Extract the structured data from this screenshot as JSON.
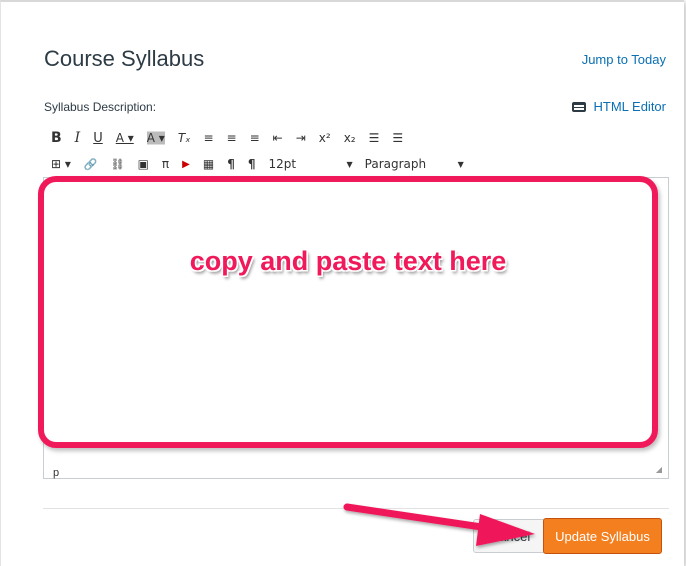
{
  "page": {
    "title": "Course Syllabus",
    "jump_link": "Jump to Today"
  },
  "editor": {
    "description_label": "Syllabus Description:",
    "html_editor_label": "HTML Editor",
    "font_size": "12pt",
    "block_format": "Paragraph",
    "path": "p",
    "toolbar_row1": [
      {
        "name": "bold-icon",
        "glyph": "B"
      },
      {
        "name": "italic-icon",
        "glyph": "I"
      },
      {
        "name": "underline-icon",
        "glyph": "U"
      },
      {
        "name": "text-color-icon",
        "glyph": "A ▾"
      },
      {
        "name": "background-color-icon",
        "glyph": "A ▾"
      },
      {
        "name": "clear-formatting-icon",
        "glyph": "Tₓ"
      },
      {
        "name": "align-left-icon",
        "glyph": "≡"
      },
      {
        "name": "align-center-icon",
        "glyph": "≡"
      },
      {
        "name": "align-right-icon",
        "glyph": "≡"
      },
      {
        "name": "outdent-icon",
        "glyph": "⇤"
      },
      {
        "name": "indent-icon",
        "glyph": "⇥"
      },
      {
        "name": "superscript-icon",
        "glyph": "x²"
      },
      {
        "name": "subscript-icon",
        "glyph": "x₂"
      },
      {
        "name": "bullet-list-icon",
        "glyph": "☰"
      },
      {
        "name": "numbered-list-icon",
        "glyph": "☰"
      }
    ],
    "toolbar_row2": [
      {
        "name": "table-icon",
        "glyph": "⊞ ▾"
      },
      {
        "name": "link-icon",
        "glyph": "🔗"
      },
      {
        "name": "unlink-icon",
        "glyph": "⛓"
      },
      {
        "name": "image-icon",
        "glyph": "▣"
      },
      {
        "name": "math-icon",
        "glyph": "π"
      },
      {
        "name": "youtube-icon",
        "glyph": "▶"
      },
      {
        "name": "media-icon",
        "glyph": "▦"
      },
      {
        "name": "ltr-icon",
        "glyph": "¶"
      },
      {
        "name": "rtl-icon",
        "glyph": "¶"
      }
    ]
  },
  "annotation": {
    "text": "copy and paste text here",
    "color": "#f0195a"
  },
  "buttons": {
    "cancel": "Cancel",
    "update": "Update Syllabus"
  },
  "colors": {
    "link": "#0a6fb3",
    "primary_button": "#f47f1f"
  }
}
